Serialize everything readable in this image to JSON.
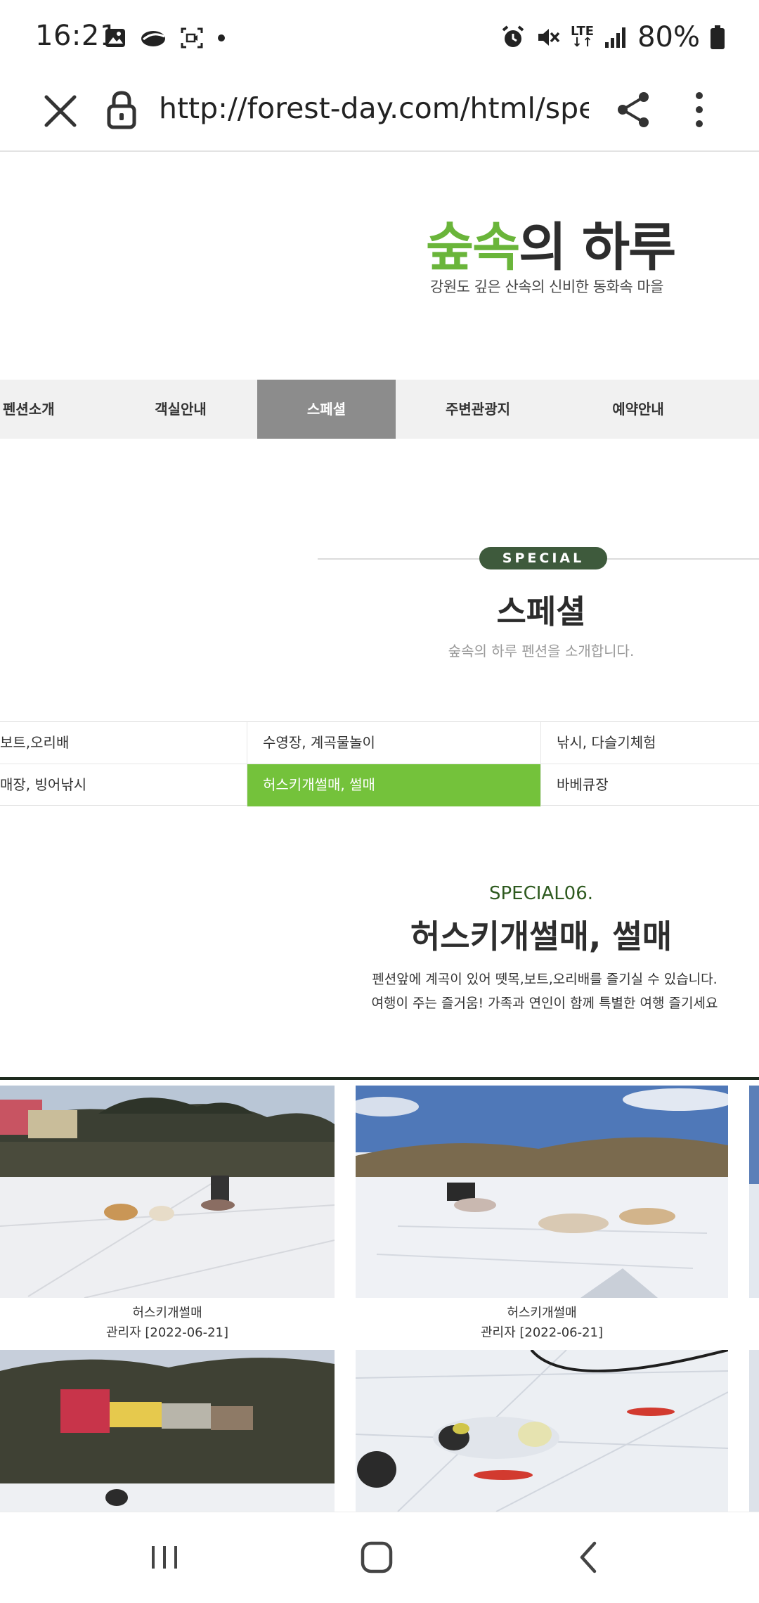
{
  "status": {
    "time": "16:21",
    "battery": "80%",
    "network": "LTE"
  },
  "browser": {
    "url": "http://forest-day.com/html/spe"
  },
  "logo": {
    "title_green": "숲속",
    "title_dark": "의 하루",
    "subtitle": "강원도 깊은 산속의 신비한 동화속 마을"
  },
  "nav": {
    "items": [
      {
        "label": "펜션소개"
      },
      {
        "label": "객실안내"
      },
      {
        "label": "스페셜"
      },
      {
        "label": "주변관광지"
      },
      {
        "label": "예약안내"
      }
    ],
    "active_index": 2
  },
  "section": {
    "badge": "SPECIAL",
    "title": "스페셜",
    "subtitle": "숲속의 하루 펜션을 소개합니다."
  },
  "categories": {
    "row1": [
      "보트,오리배",
      "수영장, 계곡물놀이",
      "낚시, 다슬기체험"
    ],
    "row2": [
      "매장, 빙어낚시",
      "허스키개썰매, 썰매",
      "바베큐장"
    ]
  },
  "special": {
    "number": "SPECIAL06.",
    "title": "허스키개썰매, 썰매",
    "desc_line1": "펜션앞에 계곡이 있어 뗏목,보트,오리배를 즐기실 수 있습니다.",
    "desc_line2": "여행이 주는 즐거움! 가족과 연인이 함께 특별한 여행 즐기세요"
  },
  "gallery": [
    {
      "title": "허스키개썰매",
      "meta": "관리자 [2022-06-21]"
    },
    {
      "title": "허스키개썰매",
      "meta": "관리자 [2022-06-21]"
    }
  ],
  "colors": {
    "accent_green": "#74c23b",
    "dark_green": "#3e5a3c",
    "nav_active": "#8c8c8c"
  }
}
